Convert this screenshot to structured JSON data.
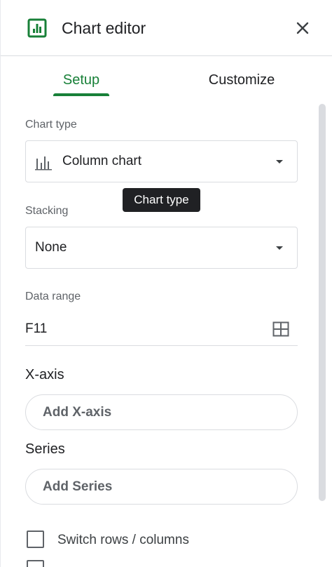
{
  "header": {
    "title": "Chart editor",
    "chart_icon": "chart-icon",
    "close_icon": "close-icon"
  },
  "tabs": [
    {
      "label": "Setup",
      "active": true
    },
    {
      "label": "Customize",
      "active": false
    }
  ],
  "chart_type": {
    "label": "Chart type",
    "value": "Column chart",
    "icon": "column-chart-icon"
  },
  "tooltip": {
    "text": "Chart type"
  },
  "stacking": {
    "label": "Stacking",
    "value": "None"
  },
  "data_range": {
    "label": "Data range",
    "value": "F11",
    "icon": "select-range-icon"
  },
  "x_axis": {
    "label": "X-axis",
    "button": "Add X-axis"
  },
  "series": {
    "label": "Series",
    "button": "Add Series"
  },
  "options": [
    {
      "label": "Switch rows / columns",
      "checked": false
    }
  ],
  "colors": {
    "accent": "#188038",
    "border": "#dadce0",
    "tooltip_bg": "#202124"
  }
}
